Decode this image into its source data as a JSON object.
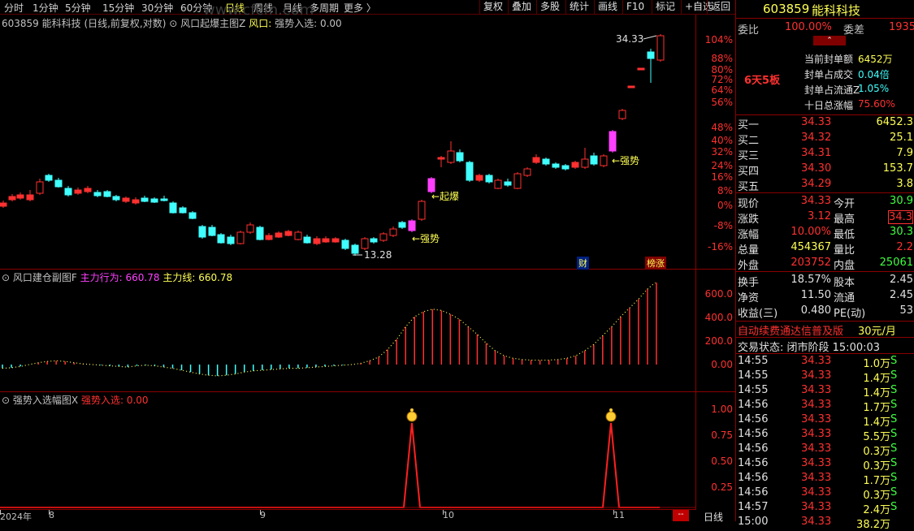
{
  "toolbar": {
    "periods": [
      "分时",
      "1分钟",
      "5分钟",
      "15分钟",
      "30分钟",
      "60分钟",
      "日线",
      "周线",
      "月线",
      "多周期",
      "更多 〉"
    ],
    "active_period": "日线",
    "buttons": [
      "复权",
      "叠加",
      "多股",
      "统计",
      "画线",
      "F10",
      "标记",
      "+自选",
      "返回"
    ]
  },
  "main_chart": {
    "stock_info": "603859 能科科技 (日线,前复权,对数)",
    "indicator_name": "风口起爆主图Z",
    "indicator_label": "风口:",
    "indicator_value": "强势入选: 0.00",
    "high_label": "34.33",
    "low_label": "13.28",
    "annotations": [
      "←强势",
      "←起爆",
      "←强势"
    ],
    "marker_cai": "财",
    "marker_bang": "榜涨",
    "y_labels": [
      "104%",
      "88%",
      "80%",
      "72%",
      "64%",
      "56%",
      "48%",
      "40%",
      "32%",
      "24%",
      "16%",
      "8%",
      "0%",
      "-8%",
      "-16%"
    ]
  },
  "sub_chart_1": {
    "name": "风口建仓副图F",
    "label1": "主力行为:",
    "value1": "660.78",
    "label2": "主力线:",
    "value2": "660.78",
    "y_labels": [
      "600.0",
      "400.0",
      "200.0",
      "0.00"
    ]
  },
  "sub_chart_2": {
    "name": "强势入选幅图X",
    "label1": "强势入选:",
    "value1": "0.00",
    "y_labels": [
      "1.00",
      "0.75",
      "0.50",
      "0.25"
    ]
  },
  "x_dates": [
    "2024年",
    "8",
    "9",
    "10",
    "11"
  ],
  "bottom_tab": "日线",
  "bottom_marker": "--",
  "watermark": "www.cfcfn.com",
  "right_panel": {
    "code": "603859",
    "name": "能科科技",
    "weibi_label": "委比",
    "weibi_value": "100.00%",
    "weicha_label": "委差",
    "weicha_value": "1935",
    "seal_items": [
      {
        "label": "当前封单额",
        "value": "6452万"
      },
      {
        "label": "封单占成交",
        "value": "0.04倍"
      },
      {
        "label": "封单占流通Z",
        "value": "1.05%"
      },
      {
        "label": "十日总涨幅",
        "value": "75.60%"
      }
    ],
    "streak": "6天5板",
    "bids": [
      {
        "label": "买一",
        "price": "34.33",
        "vol": "6452.3"
      },
      {
        "label": "买二",
        "price": "34.32",
        "vol": "25.1"
      },
      {
        "label": "买三",
        "price": "34.31",
        "vol": "7.9"
      },
      {
        "label": "买四",
        "price": "34.30",
        "vol": "153.7"
      },
      {
        "label": "买五",
        "price": "34.29",
        "vol": "3.8"
      }
    ],
    "stats": [
      {
        "l1": "现价",
        "v1": "34.33",
        "l2": "今开",
        "v2": "30.9"
      },
      {
        "l1": "涨跌",
        "v1": "3.12",
        "l2": "最高",
        "v2": "34.3"
      },
      {
        "l1": "涨幅",
        "v1": "10.00%",
        "l2": "最低",
        "v2": "30.3"
      },
      {
        "l1": "总量",
        "v1": "454367",
        "l2": "量比",
        "v2": "2.2"
      },
      {
        "l1": "外盘",
        "v1": "203752",
        "l2": "内盘",
        "v2": "25061"
      }
    ],
    "fin": [
      {
        "l1": "换手",
        "v1": "18.57%",
        "l2": "股本",
        "v2": "2.45"
      },
      {
        "l1": "净资",
        "v1": "11.50",
        "l2": "流通",
        "v2": "2.45"
      },
      {
        "l1": "收益(三)",
        "v1": "0.480",
        "l2": "PE(动)",
        "v2": "53"
      }
    ],
    "ad_text": "自动续费通达信普及版",
    "ad_price": "30元/月",
    "trade_status": "交易状态: 闭市阶段 15:00:03",
    "ticks": [
      {
        "time": "14:55",
        "price": "34.33",
        "vol": "1.0万",
        "side": "S"
      },
      {
        "time": "14:55",
        "price": "34.33",
        "vol": "1.4万",
        "side": "S"
      },
      {
        "time": "14:55",
        "price": "34.33",
        "vol": "1.4万",
        "side": "S"
      },
      {
        "time": "14:56",
        "price": "34.33",
        "vol": "1.7万",
        "side": "S"
      },
      {
        "time": "14:56",
        "price": "34.33",
        "vol": "1.4万",
        "side": "S"
      },
      {
        "time": "14:56",
        "price": "34.33",
        "vol": "5.5万",
        "side": "S"
      },
      {
        "time": "14:56",
        "price": "34.33",
        "vol": "0.3万",
        "side": "S"
      },
      {
        "time": "14:56",
        "price": "34.33",
        "vol": "0.3万",
        "side": "S"
      },
      {
        "time": "14:56",
        "price": "34.33",
        "vol": "1.7万",
        "side": "S"
      },
      {
        "time": "14:56",
        "price": "34.33",
        "vol": "0.3万",
        "side": "S"
      },
      {
        "time": "14:57",
        "price": "34.33",
        "vol": "2.4万",
        "side": "S"
      },
      {
        "time": "15:00",
        "price": "34.33",
        "vol": "38.2万",
        "side": ""
      }
    ]
  },
  "colors": {
    "up": "#ff3030",
    "down": "#40ffff",
    "boost": "#ff40ff",
    "label": "#ffff55",
    "grid": "#8b0000"
  }
}
